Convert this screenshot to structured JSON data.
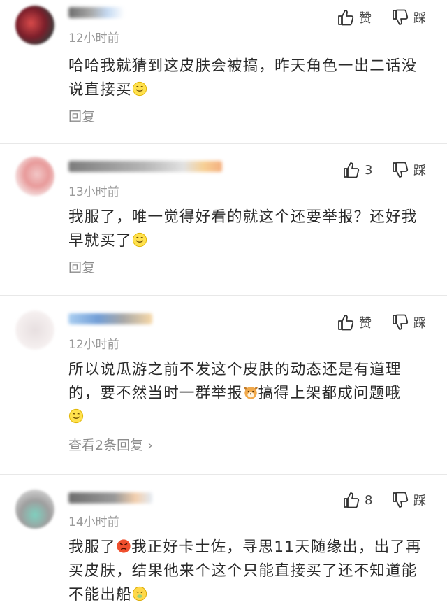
{
  "actions": {
    "like_label": "赞",
    "dislike_label": "踩"
  },
  "comments": [
    {
      "time": "12小时前",
      "text_a": "哈哈我就猜到这皮肤会被搞，昨天角色一出二话没说直接买",
      "emoji_a": "smile-emoji",
      "like_count": "",
      "reply_label": "回复"
    },
    {
      "time": "13小时前",
      "text_a": "我服了，唯一觉得好看的就这个还要举报？还好我早就买了",
      "emoji_a": "smile-emoji",
      "like_count": "3",
      "reply_label": "回复"
    },
    {
      "time": "12小时前",
      "text_a": "所以说瓜游之前不发这个皮肤的动态还是有道理的，要不然当时一群举报",
      "emoji_a": "dog-emoji",
      "text_b": "搞得上架都成问题哦",
      "emoji_b": "smile-emoji",
      "like_count": "",
      "reply_label": "查看2条回复",
      "reply_chevron": "›"
    },
    {
      "time": "14小时前",
      "text_a": "我服了",
      "emoji_a": "angry-emoji",
      "text_b": "我正好卡士佐，寻思11天随缘出，出了再买皮肤，结果他来个这个只能直接买了还不知道能不能出船",
      "emoji_b": "sick-emoji",
      "like_count": "8",
      "reply_label": ""
    }
  ]
}
